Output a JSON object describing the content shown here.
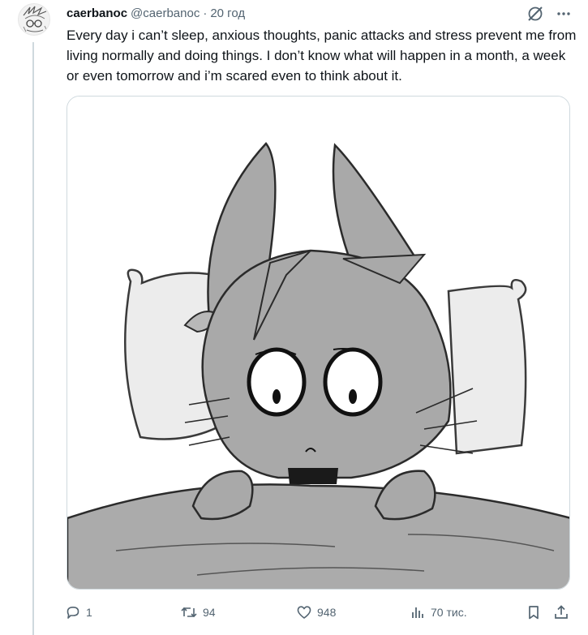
{
  "tweet": {
    "display_name": "caerbanoc",
    "handle": "@caerbanoc",
    "separator": "·",
    "time": "20 год",
    "text": "Every day i can’t sleep, anxious thoughts, panic attacks and stress prevent me from living normally and doing things. I don’t know what will happen in a month, a week or even tomorrow and i’m scared even to think about it."
  },
  "icons": {
    "grok": "grok-icon",
    "more": "more-icon",
    "reply": "reply-icon",
    "retweet": "retweet-icon",
    "like": "like-icon",
    "views": "views-icon",
    "bookmark": "bookmark-icon",
    "share": "share-icon"
  },
  "actions": {
    "replies": "1",
    "retweets": "94",
    "likes": "948",
    "views": "70 тис."
  },
  "colors": {
    "text": "#0f1419",
    "muted": "#536471",
    "border": "#cfd9de"
  }
}
